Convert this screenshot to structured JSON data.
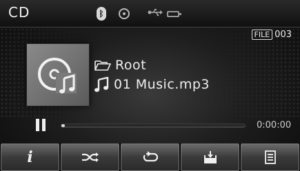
{
  "header": {
    "mode_title": "CD",
    "status_icons": [
      "bluetooth-icon",
      "disc-icon",
      "usb-icon",
      "battery-icon"
    ]
  },
  "file_badge": {
    "label": "FILE",
    "number": "003"
  },
  "now_playing": {
    "folder_icon": "folder-icon",
    "folder_name": "Root",
    "track_icon": "music-note-icon",
    "track_name": "01 Music.mp3",
    "album_art_icon": "music-disc-icon"
  },
  "playback": {
    "state_icon": "pause-icon",
    "progress_fraction": 0,
    "elapsed_time": "0:00:00"
  },
  "softkeys": [
    {
      "icon": "info-icon"
    },
    {
      "icon": "shuffle-icon"
    },
    {
      "icon": "repeat-icon"
    },
    {
      "icon": "save-icon"
    },
    {
      "icon": "list-icon"
    }
  ],
  "colors": {
    "text": "#e8e8e8",
    "background": "#1e1e1e",
    "softkey": "#4a4a4a"
  }
}
